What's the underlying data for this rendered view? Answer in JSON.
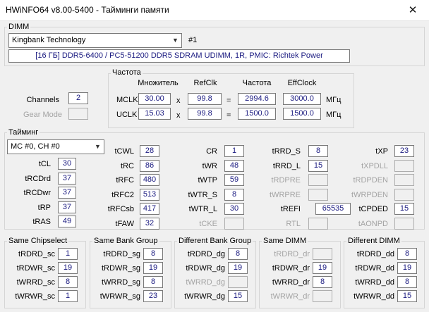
{
  "window": {
    "title": "HWiNFO64 v8.00-5400 - Тайминги памяти",
    "close_glyph": "✕"
  },
  "dimm": {
    "group_title": "DIMM",
    "selected_module": "Kingbank Technology",
    "slot": "#1",
    "info": "[16 ГБ] DDR5-6400 / PC5-51200 DDR5 SDRAM UDIMM, 1R, PMIC: Richtek Power"
  },
  "channels": {
    "channels_label": "Channels",
    "channels_value": "2",
    "gear_mode_label": "Gear Mode",
    "gear_mode_value": ""
  },
  "frequency": {
    "group_title": "Частота",
    "col_multiplier": "Множитель",
    "col_refclk": "RefClk",
    "col_freq": "Частота",
    "col_effclock": "EffClock",
    "rows": [
      {
        "label": "MCLK",
        "multiplier": "30.00",
        "times": "x",
        "refclk": "99.8",
        "equals": "=",
        "freq": "2994.6",
        "effclock": "3000.0",
        "unit": "МГц"
      },
      {
        "label": "UCLK",
        "multiplier": "15.03",
        "times": "x",
        "refclk": "99.8",
        "equals": "=",
        "freq": "1500.0",
        "effclock": "1500.0",
        "unit": "МГц"
      }
    ]
  },
  "timings": {
    "group_title": "Тайминг",
    "channel_select": "MC #0, CH #0",
    "col1": [
      {
        "label": "tCL",
        "value": "30",
        "enabled": true
      },
      {
        "label": "tRCDrd",
        "value": "37",
        "enabled": true
      },
      {
        "label": "tRCDwr",
        "value": "37",
        "enabled": true
      },
      {
        "label": "tRP",
        "value": "37",
        "enabled": true
      },
      {
        "label": "tRAS",
        "value": "49",
        "enabled": true
      }
    ],
    "col2": [
      {
        "label": "tCWL",
        "value": "28",
        "enabled": true
      },
      {
        "label": "tRC",
        "value": "86",
        "enabled": true
      },
      {
        "label": "tRFC",
        "value": "480",
        "enabled": true
      },
      {
        "label": "tRFC2",
        "value": "513",
        "enabled": true
      },
      {
        "label": "tRFCsb",
        "value": "417",
        "enabled": true
      },
      {
        "label": "tFAW",
        "value": "32",
        "enabled": true
      }
    ],
    "col3": [
      {
        "label": "CR",
        "value": "1",
        "enabled": true
      },
      {
        "label": "tWR",
        "value": "48",
        "enabled": true
      },
      {
        "label": "tWTP",
        "value": "59",
        "enabled": true
      },
      {
        "label": "tWTR_S",
        "value": "8",
        "enabled": true
      },
      {
        "label": "tWTR_L",
        "value": "30",
        "enabled": true
      },
      {
        "label": "tCKE",
        "value": "",
        "enabled": false
      }
    ],
    "col4": [
      {
        "label": "tRRD_S",
        "value": "8",
        "enabled": true
      },
      {
        "label": "tRRD_L",
        "value": "15",
        "enabled": true
      },
      {
        "label": "tRDPRE",
        "value": "",
        "enabled": false
      },
      {
        "label": "tWRPRE",
        "value": "",
        "enabled": false
      },
      {
        "label": "tREFI",
        "value": "65535",
        "enabled": true
      },
      {
        "label": "RTL",
        "value": "",
        "enabled": false
      }
    ],
    "col5": [
      {
        "label": "tXP",
        "value": "23",
        "enabled": true
      },
      {
        "label": "tXPDLL",
        "value": "",
        "enabled": false
      },
      {
        "label": "tRDPDEN",
        "value": "",
        "enabled": false
      },
      {
        "label": "tWRPDEN",
        "value": "",
        "enabled": false
      },
      {
        "label": "tCPDED",
        "value": "15",
        "enabled": true
      },
      {
        "label": "tAONPD",
        "value": "",
        "enabled": false
      }
    ]
  },
  "turnaround": [
    {
      "title": "Same Chipselect",
      "rows": [
        {
          "label": "tRDRD_sc",
          "value": "1",
          "enabled": true
        },
        {
          "label": "tRDWR_sc",
          "value": "19",
          "enabled": true
        },
        {
          "label": "tWRRD_sc",
          "value": "8",
          "enabled": true
        },
        {
          "label": "tWRWR_sc",
          "value": "1",
          "enabled": true
        }
      ]
    },
    {
      "title": "Same Bank Group",
      "rows": [
        {
          "label": "tRDRD_sg",
          "value": "8",
          "enabled": true
        },
        {
          "label": "tRDWR_sg",
          "value": "19",
          "enabled": true
        },
        {
          "label": "tWRRD_sg",
          "value": "8",
          "enabled": true
        },
        {
          "label": "tWRWR_sg",
          "value": "23",
          "enabled": true
        }
      ]
    },
    {
      "title": "Different Bank Group",
      "rows": [
        {
          "label": "tRDRD_dg",
          "value": "8",
          "enabled": true
        },
        {
          "label": "tRDWR_dg",
          "value": "19",
          "enabled": true
        },
        {
          "label": "tWRRD_dg",
          "value": "",
          "enabled": false
        },
        {
          "label": "tWRWR_dg",
          "value": "15",
          "enabled": true
        }
      ]
    },
    {
      "title": "Same DIMM",
      "rows": [
        {
          "label": "tRDRD_dr",
          "value": "",
          "enabled": false
        },
        {
          "label": "tRDWR_dr",
          "value": "19",
          "enabled": true
        },
        {
          "label": "tWRRD_dr",
          "value": "8",
          "enabled": true
        },
        {
          "label": "tWRWR_dr",
          "value": "",
          "enabled": false
        }
      ]
    },
    {
      "title": "Different DIMM",
      "rows": [
        {
          "label": "tRDRD_dd",
          "value": "8",
          "enabled": true
        },
        {
          "label": "tRDWR_dd",
          "value": "19",
          "enabled": true
        },
        {
          "label": "tWRRD_dd",
          "value": "8",
          "enabled": true
        },
        {
          "label": "tWRWR_dd",
          "value": "15",
          "enabled": true
        }
      ]
    }
  ]
}
